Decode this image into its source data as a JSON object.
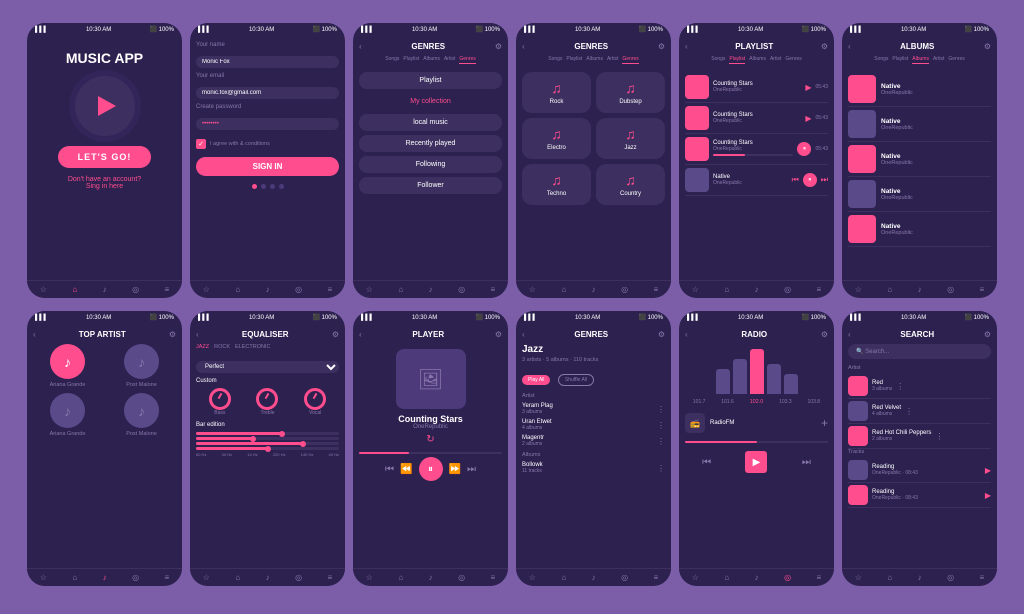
{
  "screens": [
    {
      "id": "s1",
      "title": "MUSIC APP",
      "cta": "LET'S GO!",
      "no_account": "Don't have an account?",
      "sign_in_here": "Sing in here"
    },
    {
      "id": "s2",
      "name_label": "Your name",
      "name_value": "Monic Fox",
      "email_label": "Your email",
      "email_value": "monic.fox@gmail.com",
      "password_label": "Create password",
      "password_value": "••••••••",
      "agree_text": "I agree with & conditions",
      "signin_btn": "SIGN IN"
    },
    {
      "id": "s3",
      "title": "GENRES",
      "tabs": [
        "Songs",
        "Playlist",
        "Albums",
        "Artist",
        "Genres"
      ],
      "menu_items": [
        "Playlist",
        "My collection",
        "local music",
        "Recently played",
        "Following",
        "Follower"
      ]
    },
    {
      "id": "s4",
      "title": "GENRES",
      "tabs": [
        "Songs",
        "Playlist",
        "Albums",
        "Artist",
        "Genres"
      ],
      "genres": [
        "Rock",
        "Dubstep",
        "Electro",
        "Jazz",
        "Techno",
        "Country"
      ]
    },
    {
      "id": "s5",
      "title": "PLAYLIST",
      "tabs": [
        "Songs",
        "Playlist",
        "Albums",
        "Artist",
        "Genres"
      ],
      "tracks": [
        {
          "title": "Counting Stars",
          "artist": "OneRepublic",
          "duration": "05:43"
        },
        {
          "title": "Counting Stars",
          "artist": "OneRepublic",
          "duration": "05:43"
        },
        {
          "title": "Counting Stars",
          "artist": "OneRepublic",
          "duration": "05:43"
        },
        {
          "title": "Counting Stars",
          "artist": "OneRepublic",
          "duration": "05:43"
        },
        {
          "title": "Native",
          "artist": "OneRepublic",
          "duration": ""
        }
      ]
    },
    {
      "id": "s6",
      "title": "ALBUMS",
      "tabs": [
        "Songs",
        "Playlist",
        "Albums",
        "Artist",
        "Genres"
      ],
      "albums": [
        {
          "title": "Native",
          "artist": "OneRepublic"
        },
        {
          "title": "Native",
          "artist": "OneRepublic"
        },
        {
          "title": "Native",
          "artist": "OneRepublic"
        },
        {
          "title": "Native",
          "artist": "OneRepublic"
        },
        {
          "title": "Native",
          "artist": "OneRepublic"
        }
      ]
    },
    {
      "id": "s7",
      "title": "TOP ARTIST",
      "artists": [
        "Ariana Grande",
        "Post Malone",
        "Ariana Grande",
        "Post Malone"
      ]
    },
    {
      "id": "s8",
      "title": "EQUALISER",
      "tabs": [
        "JAZZ",
        "ROCK",
        "ELECTRONIC"
      ],
      "preset": "Perfect",
      "knobs": [
        "Bass",
        "Treble",
        "Vocal"
      ],
      "section": "Bar edition",
      "freqs": [
        "60 Hz",
        "30 Hz",
        "14 Hz",
        "220 Hz",
        "140 Hz",
        "40 Hz"
      ]
    },
    {
      "id": "s9",
      "title": "PLAYER",
      "track": "Counting Stars",
      "artist": "OneRepublic"
    },
    {
      "id": "s10",
      "title": "GENRES",
      "genre": "Jazz",
      "stats": "3 artists · 5 albums · 110 tracks",
      "pills": [
        "Play All",
        "Shuffle All"
      ],
      "sections": {
        "artist": "Artist",
        "albums": "Albums"
      },
      "artists": [
        {
          "name": "Yeram Plag",
          "count": "3 albums"
        },
        {
          "name": "Uran Etwet",
          "count": "4 albums"
        },
        {
          "name": "Magentr",
          "count": "2 albums"
        }
      ],
      "album_items": [
        {
          "name": "Bollowk",
          "count": "11 tracks"
        }
      ]
    },
    {
      "id": "s11",
      "title": "RADIO",
      "frequencies": [
        "101.7",
        "101.6",
        "102.0",
        "103.3",
        "103.8"
      ],
      "active_freq": "102.0",
      "station": "RadioFM"
    },
    {
      "id": "s12",
      "title": "SEARCH",
      "search_placeholder": "Search...",
      "artist_label": "Artist",
      "track_label": "Tracks",
      "artists": [
        {
          "name": "Red",
          "count": "3 albums"
        },
        {
          "name": "Red Velvet",
          "count": "4 albums"
        },
        {
          "name": "Red Hot Chili Peppers",
          "count": "2 albums"
        }
      ],
      "tracks": [
        {
          "name": "Reading",
          "info": "OneRepublic · 08:43"
        },
        {
          "name": "Reading",
          "info": "OneRepublic · 08:43"
        }
      ]
    }
  ],
  "nav": {
    "items": [
      "☆",
      "⌂",
      "♪",
      "◎",
      "≡"
    ]
  }
}
